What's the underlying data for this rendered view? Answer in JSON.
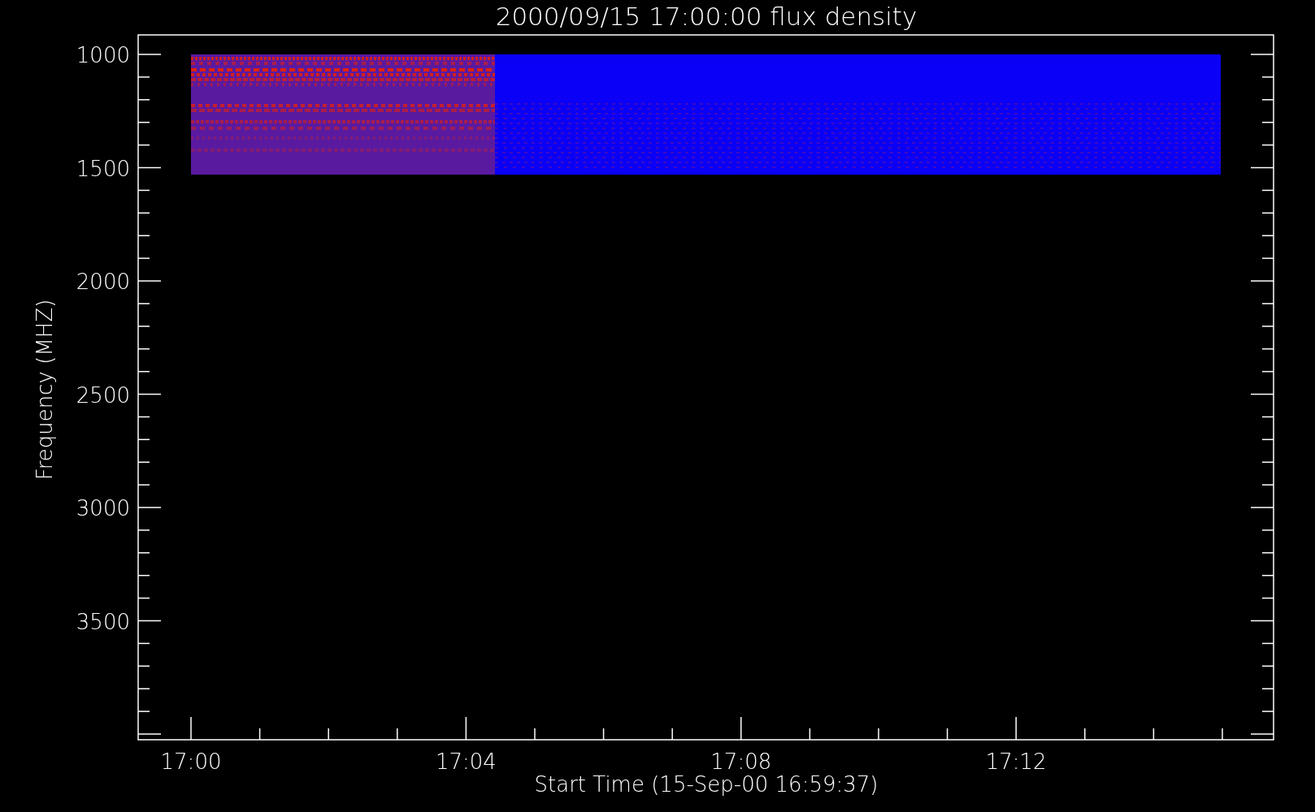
{
  "plot": {
    "title": "2000/09/15 17:00:00 flux density",
    "xlabel": "Start Time (15-Sep-00 16:59:37)",
    "ylabel": "Frequency (MHZ)",
    "x_tick_labels": [
      "17:00",
      "17:04",
      "17:08",
      "17:12"
    ],
    "y_tick_labels": [
      "1000",
      "1500",
      "2000",
      "2500",
      "3000",
      "3500"
    ]
  }
}
